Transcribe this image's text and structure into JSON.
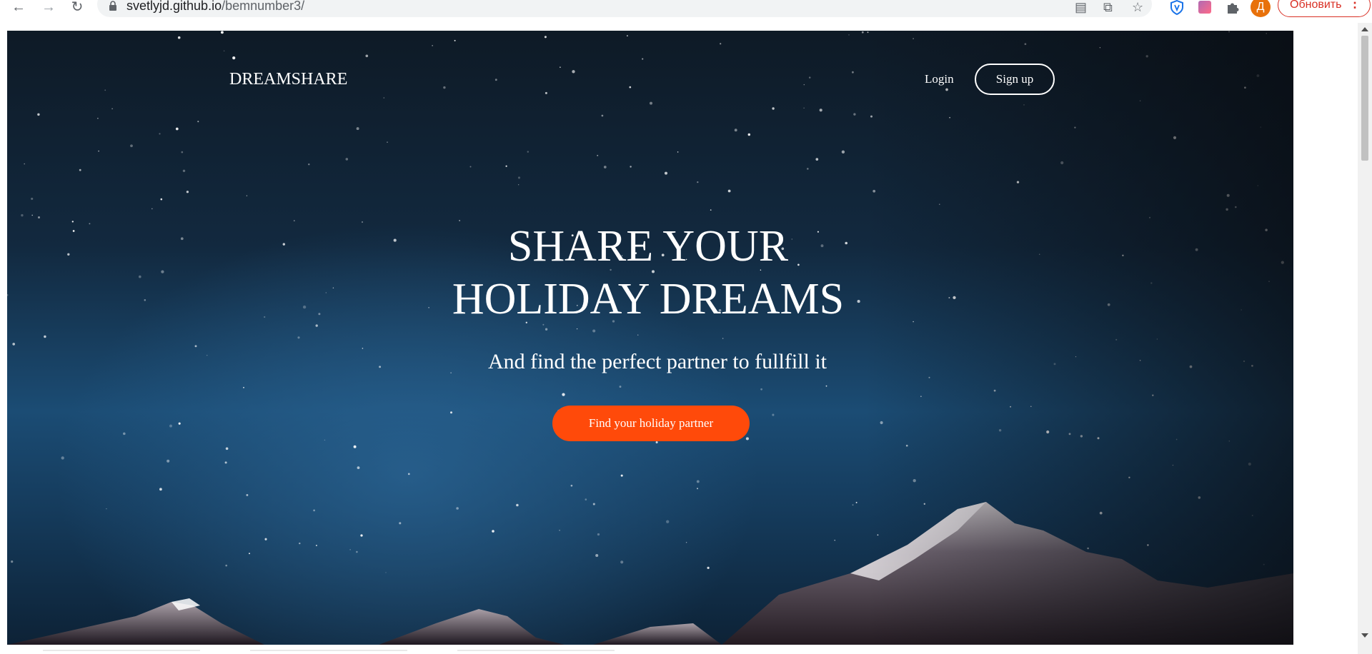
{
  "browser": {
    "url_host": "svetlyjd.github.io",
    "url_path": "/bemnumber3/",
    "avatar_letter": "Д",
    "update_label": "Обновить",
    "menu_glyph": "⋮"
  },
  "site": {
    "brand": "DREAMSHARE",
    "nav": {
      "login": "Login",
      "signup": "Sign up"
    },
    "hero": {
      "headline_line1": "SHARE YOUR",
      "headline_line2": "HOLIDAY DREAMS",
      "subheadline": "And find the perfect partner to fullfill it",
      "cta": "Find your holiday partner"
    }
  },
  "colors": {
    "cta_background": "#ff4a0a",
    "update_accent": "#d93025",
    "hero_night_sky": "#12293f"
  }
}
